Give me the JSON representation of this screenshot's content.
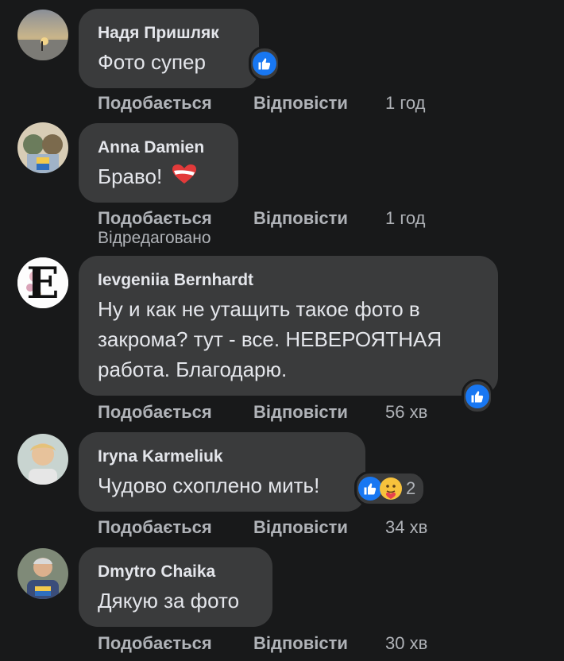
{
  "comments": [
    {
      "author": "Надя Пришляк",
      "text": "Фото супер",
      "like": "Подобається",
      "reply": "Відповісти",
      "time": "1 год"
    },
    {
      "author": "Anna Damien",
      "text": "Браво!",
      "like": "Подобається",
      "reply": "Відповісти",
      "time": "1 год",
      "edited": "Відредаговано"
    },
    {
      "author": "Ievgeniia Bernhardt",
      "text": "Ну и как не утащить такое фото в закрома? тут - все. НЕВЕРОЯТНАЯ работа. Благодарю.",
      "like": "Подобається",
      "reply": "Відповісти",
      "time": "56 хв"
    },
    {
      "author": "Iryna Karmeliuk",
      "text": "Чудово схоплено мить!",
      "like": "Подобається",
      "reply": "Відповісти",
      "time": "34 хв",
      "reaction_count": "2"
    },
    {
      "author": "Dmytro Chaika",
      "text": "Дякую за фото",
      "like": "Подобається",
      "reply": "Відповісти",
      "time": "30 хв"
    }
  ],
  "avatar_letters": {
    "c3": "E"
  },
  "icons": {
    "like": "thumbs-up-icon",
    "heart": "heart-icon",
    "care": "care-hug-icon"
  },
  "colors": {
    "background": "#18191a",
    "bubble": "#3a3b3c",
    "like_blue": "#1877f2",
    "meta": "#b0b3b8"
  }
}
